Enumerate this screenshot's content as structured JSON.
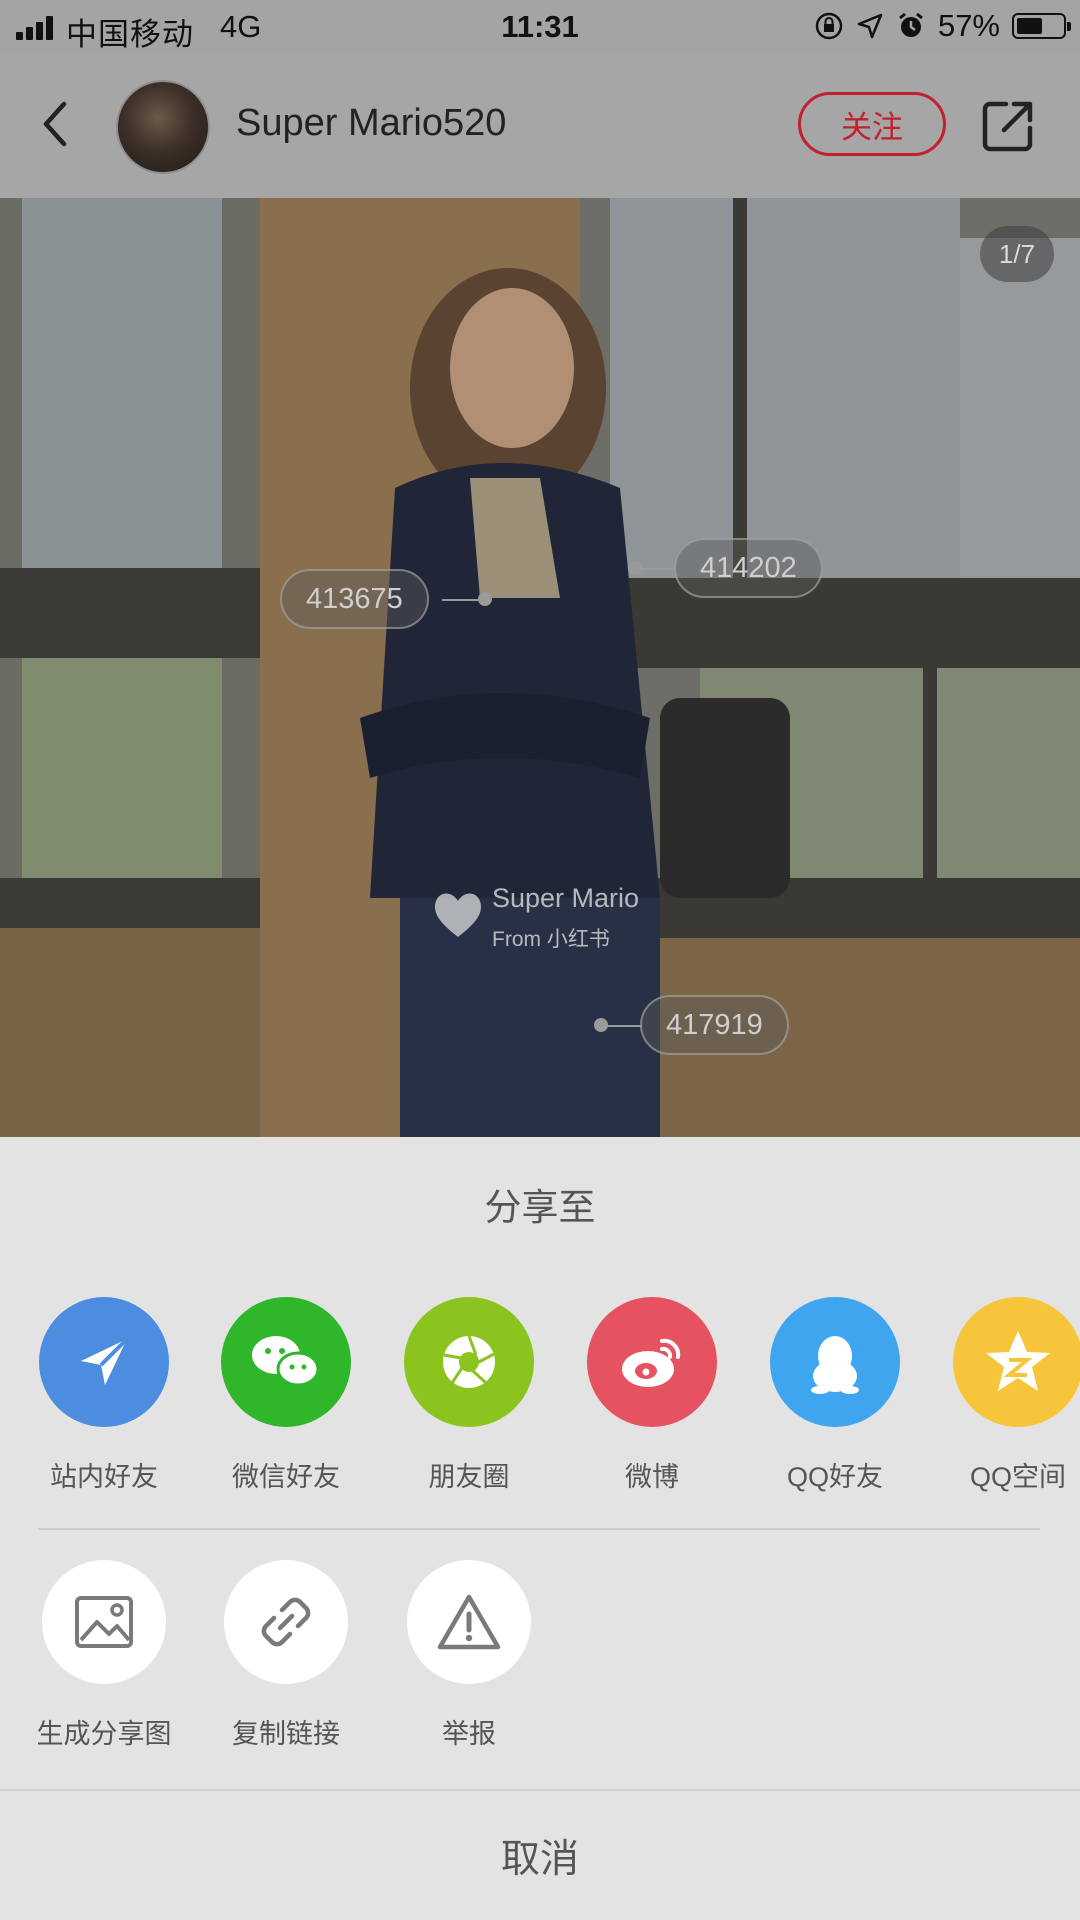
{
  "status_bar": {
    "carrier": "中国移动",
    "network": "4G",
    "time": "11:31",
    "battery_percent": "57%",
    "battery_level": 0.57
  },
  "header": {
    "username": "Super Mario520",
    "follow_label": "关注"
  },
  "photo": {
    "page_indicator": "1/7",
    "tags": [
      "413675",
      "414202",
      "417919"
    ],
    "watermark_name": "Super Mario",
    "watermark_from": "From 小红书"
  },
  "share_sheet": {
    "title": "分享至",
    "targets": [
      {
        "label": "站内好友",
        "icon": "paper-plane-icon",
        "color": "#4d8de0"
      },
      {
        "label": "微信好友",
        "icon": "wechat-icon",
        "color": "#2fb62a"
      },
      {
        "label": "朋友圈",
        "icon": "moments-shutter-icon",
        "color": "#8cc41f"
      },
      {
        "label": "微博",
        "icon": "weibo-icon",
        "color": "#e55361"
      },
      {
        "label": "QQ好友",
        "icon": "qq-penguin-icon",
        "color": "#3fa5ee"
      },
      {
        "label": "QQ空间",
        "icon": "qzone-star-icon",
        "color": "#f7c53a"
      }
    ],
    "actions": [
      {
        "label": "生成分享图",
        "icon": "image-icon"
      },
      {
        "label": "复制链接",
        "icon": "link-icon"
      },
      {
        "label": "举报",
        "icon": "warning-icon"
      }
    ],
    "cancel_label": "取消"
  }
}
